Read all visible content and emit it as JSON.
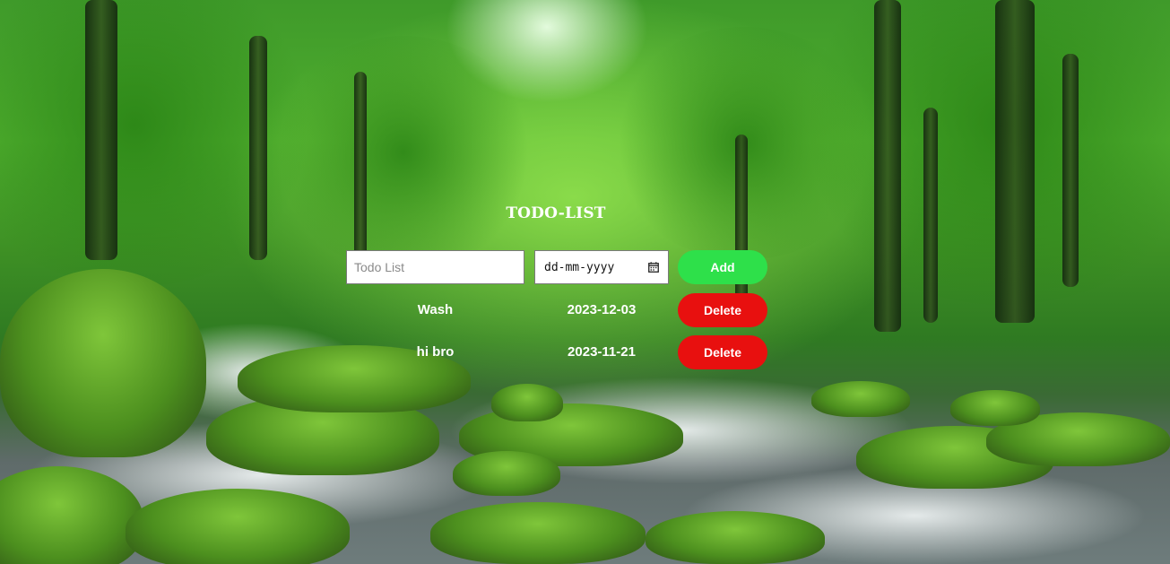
{
  "app": {
    "title": "TODO-LIST"
  },
  "form": {
    "todo_placeholder": "Todo List",
    "todo_value": "",
    "date_placeholder": "dd-mm-yyyy",
    "add_label": "Add"
  },
  "items": [
    {
      "name": "Wash",
      "date": "2023-12-03",
      "delete_label": "Delete"
    },
    {
      "name": "hi bro",
      "date": "2023-11-21",
      "delete_label": "Delete"
    }
  ],
  "colors": {
    "add_button": "#2ee04a",
    "delete_button": "#e8100f",
    "text": "#ffffff"
  },
  "icons": {
    "date_picker": "calendar-icon"
  }
}
